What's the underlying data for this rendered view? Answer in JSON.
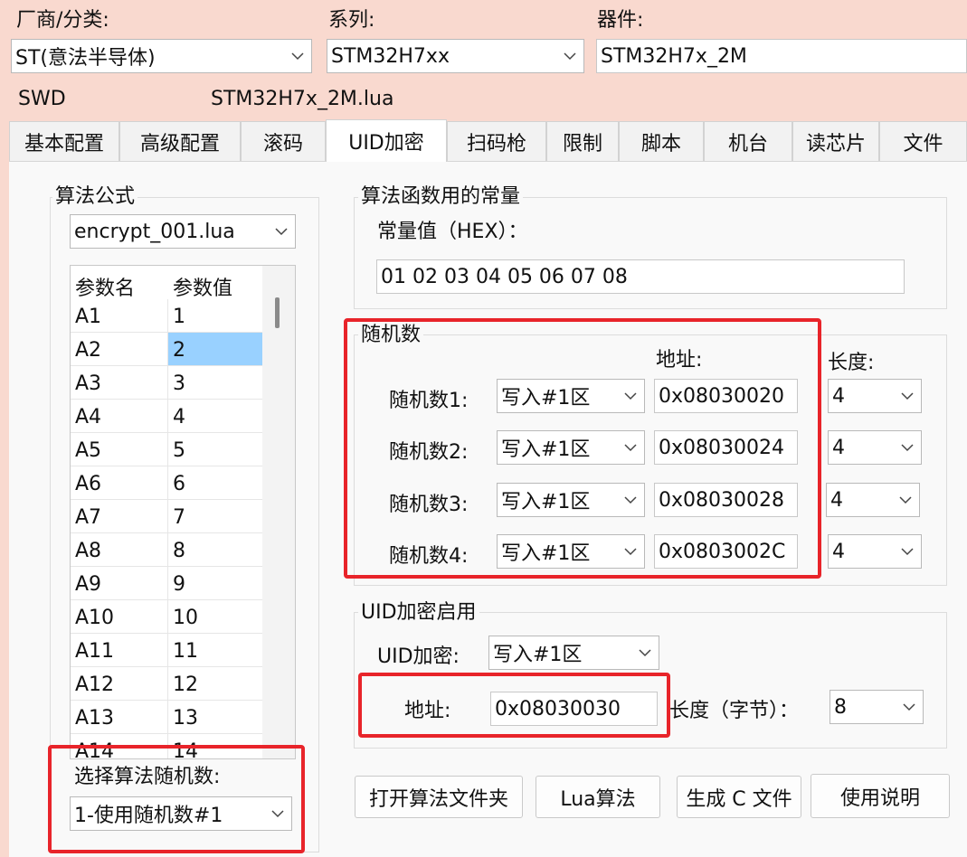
{
  "header": {
    "vendor_label": "厂商/分类:",
    "series_label": "系列:",
    "device_label": "器件:",
    "vendor_value": "ST(意法半导体)",
    "series_value": "STM32H7xx",
    "device_value": "STM32H7x_2M",
    "interface": "SWD",
    "script_file": "STM32H7x_2M.lua"
  },
  "tabs": [
    "基本配置",
    "高级配置",
    "滚码",
    "UID加密",
    "扫码枪",
    "限制",
    "脚本",
    "机台",
    "读芯片",
    "文件"
  ],
  "active_tab": "UID加密",
  "algorithm": {
    "group_title": "算法公式",
    "file": "encrypt_001.lua",
    "col_name": "参数名",
    "col_value": "参数值",
    "params": [
      {
        "name": "A1",
        "value": "1"
      },
      {
        "name": "A2",
        "value": "2"
      },
      {
        "name": "A3",
        "value": "3"
      },
      {
        "name": "A4",
        "value": "4"
      },
      {
        "name": "A5",
        "value": "5"
      },
      {
        "name": "A6",
        "value": "6"
      },
      {
        "name": "A7",
        "value": "7"
      },
      {
        "name": "A8",
        "value": "8"
      },
      {
        "name": "A9",
        "value": "9"
      },
      {
        "name": "A10",
        "value": "10"
      },
      {
        "name": "A11",
        "value": "11"
      },
      {
        "name": "A12",
        "value": "12"
      },
      {
        "name": "A13",
        "value": "13"
      },
      {
        "name": "A14",
        "value": "14"
      }
    ],
    "selected_param": "A2",
    "random_select_label": "选择算法随机数:",
    "random_select_value": "1-使用随机数#1"
  },
  "constants": {
    "group_title": "算法函数用的常量",
    "label": "常量值（HEX）：",
    "value": "01 02 03 04 05 06 07 08"
  },
  "random": {
    "group_title": "随机数",
    "addr_header": "地址:",
    "len_header": "长度:",
    "rows": [
      {
        "label": "随机数1:",
        "mode": "写入#1区",
        "addr": "0x08030020",
        "len": "4"
      },
      {
        "label": "随机数2:",
        "mode": "写入#1区",
        "addr": "0x08030024",
        "len": "4"
      },
      {
        "label": "随机数3:",
        "mode": "写入#1区",
        "addr": "0x08030028",
        "len": "4"
      },
      {
        "label": "随机数4:",
        "mode": "写入#1区",
        "addr": "0x0803002C",
        "len": "4"
      }
    ]
  },
  "uid": {
    "group_title": "UID加密启用",
    "enc_label": "UID加密:",
    "enc_value": "写入#1区",
    "addr_label": "地址:",
    "addr_value": "0x08030030",
    "len_label": "长度（字节）：",
    "len_value": "8"
  },
  "buttons": {
    "open_folder": "打开算法文件夹",
    "lua": "Lua算法",
    "gen_c": "生成 C 文件",
    "help": "使用说明"
  },
  "colors": {
    "window_bg": "#f9d9cf",
    "highlight": "#e8242a",
    "selection": "#99d1ff"
  }
}
